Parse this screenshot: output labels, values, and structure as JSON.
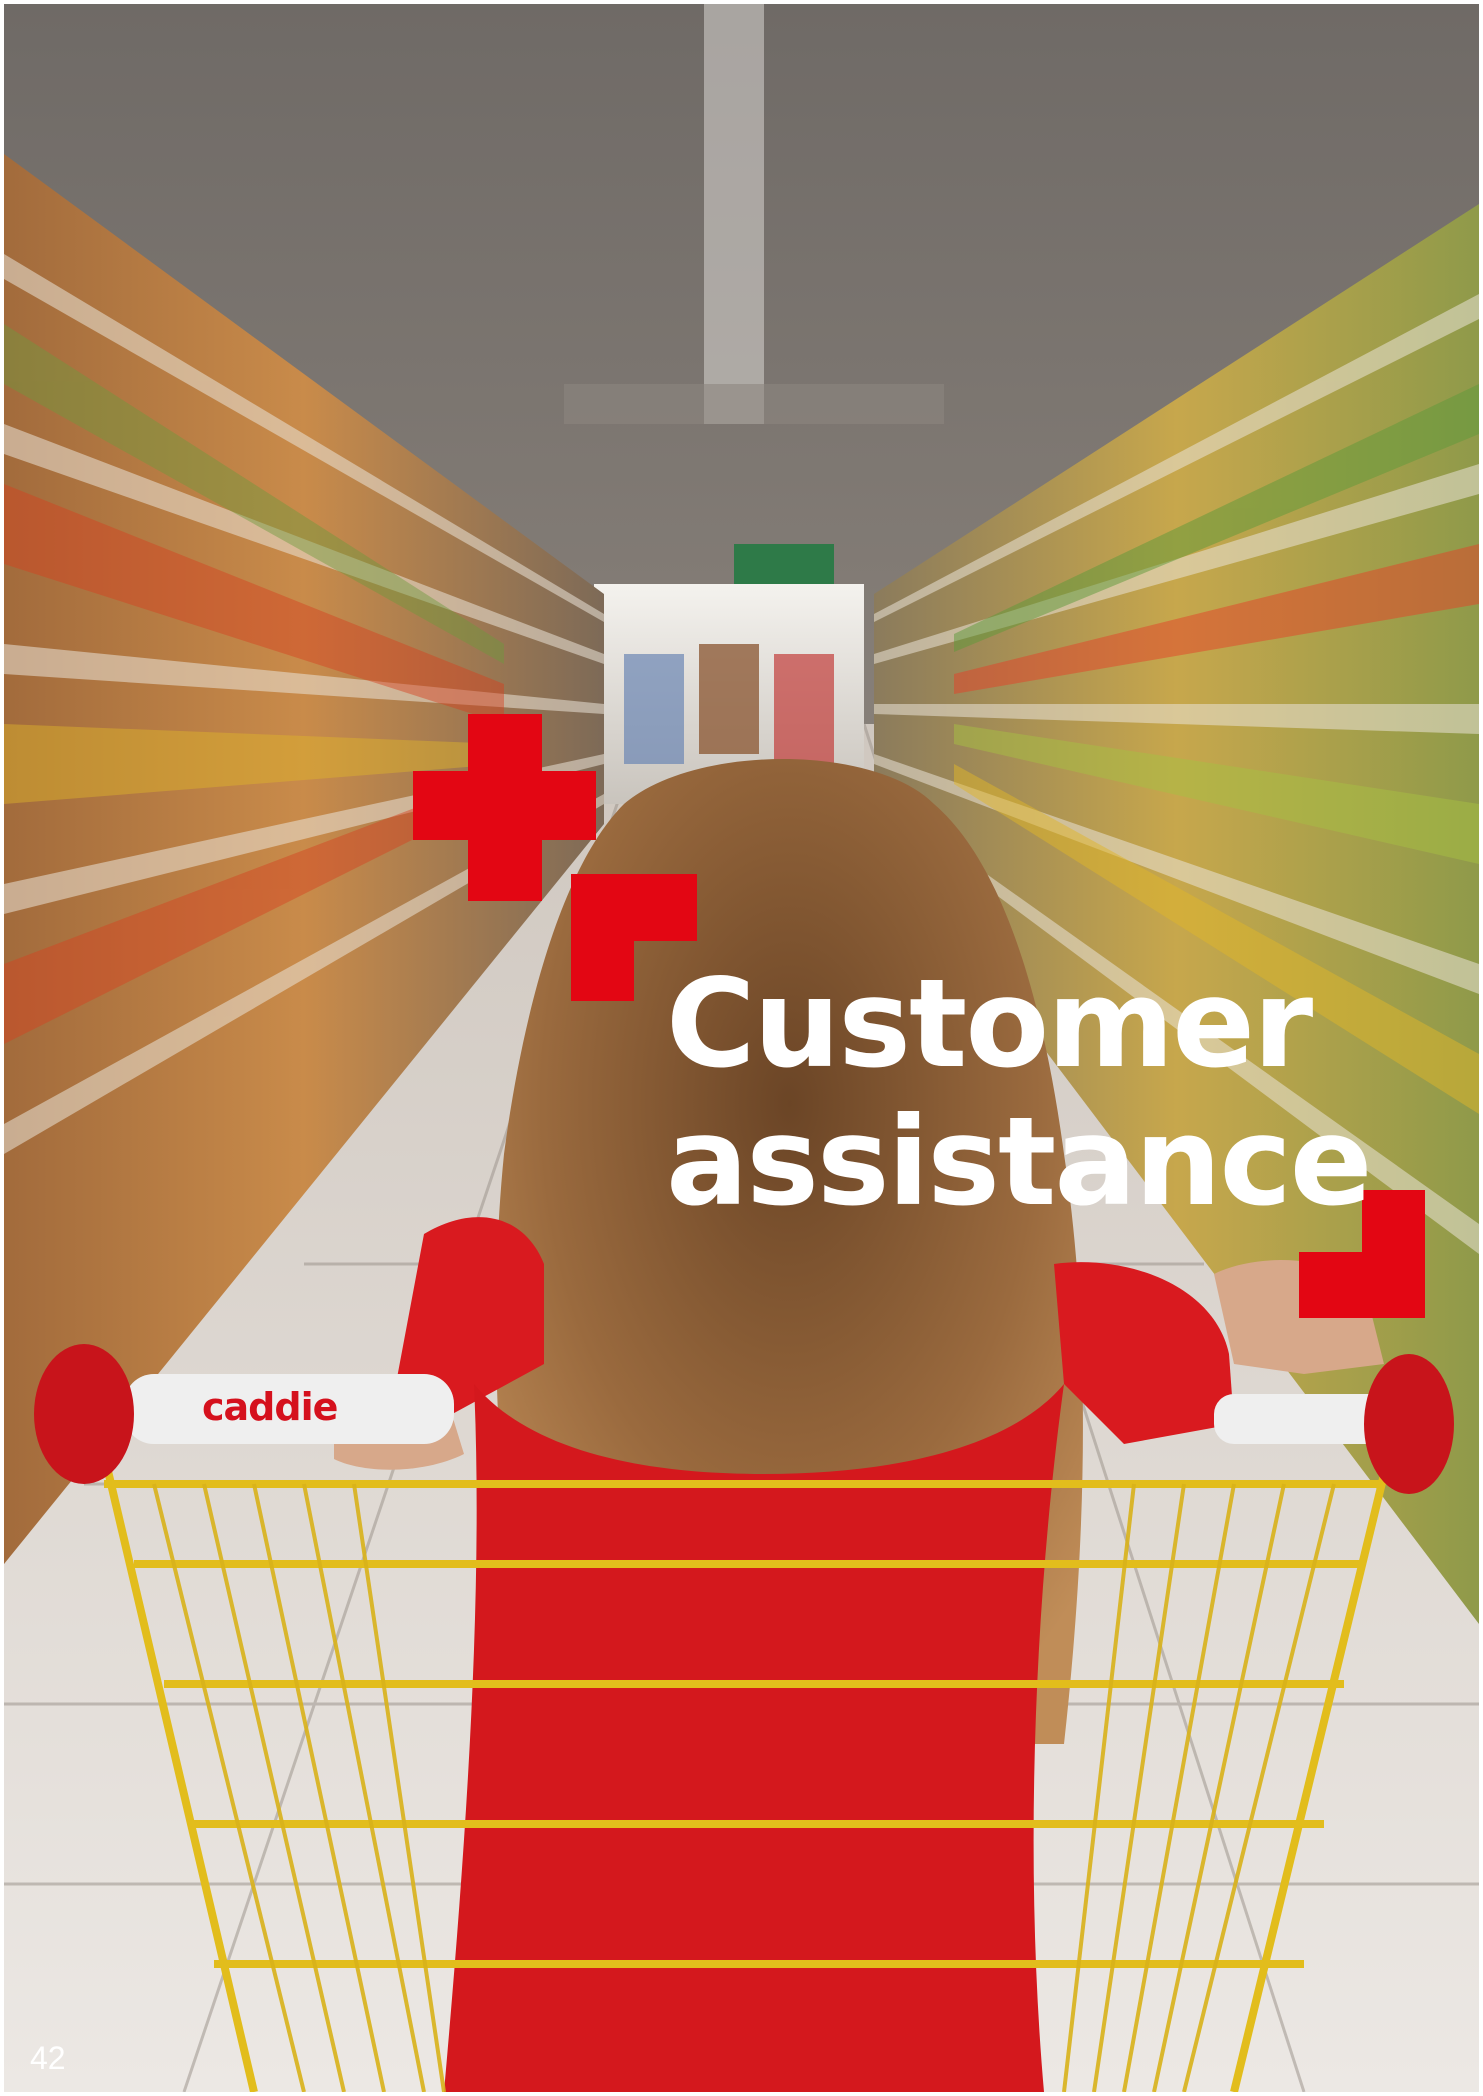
{
  "page": {
    "title_line1": "Customer",
    "title_line2": "assistance",
    "page_number": "42",
    "cart_brand": "caddie"
  },
  "colors": {
    "accent": "#e30613",
    "title_text": "#ffffff",
    "shirt": "#d91a1f",
    "cart": "#e8c41f"
  },
  "photo": {
    "subject": "child pushing yellow shopping cart in supermarket aisle"
  }
}
